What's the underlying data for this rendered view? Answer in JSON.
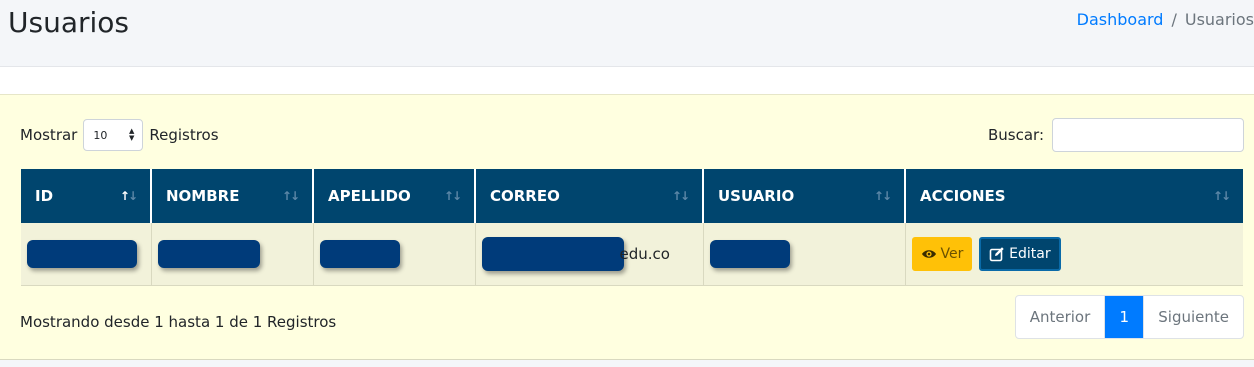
{
  "header": {
    "title": "Usuarios",
    "breadcrumb": {
      "home": "Dashboard",
      "separator": "/",
      "current": "Usuarios"
    }
  },
  "controls": {
    "show_label": "Mostrar",
    "length_value": "10",
    "records_label": "Registros",
    "search_label": "Buscar:"
  },
  "table": {
    "columns": [
      "ID",
      "NOMBRE",
      "APELLIDO",
      "CORREO",
      "USUARIO",
      "ACCIONES"
    ],
    "rows": [
      {
        "email_visible_suffix": "edu.co",
        "view_label": "Ver",
        "edit_label": "Editar"
      }
    ]
  },
  "footer": {
    "info": "Mostrando desde 1 hasta 1 de 1 Registros",
    "pagination": {
      "prev": "Anterior",
      "current": "1",
      "next": "Siguiente"
    }
  },
  "colors": {
    "header_bg": "#00456e",
    "card_bg": "#ffffe0",
    "accent": "#007bff",
    "warning": "#ffc107"
  }
}
